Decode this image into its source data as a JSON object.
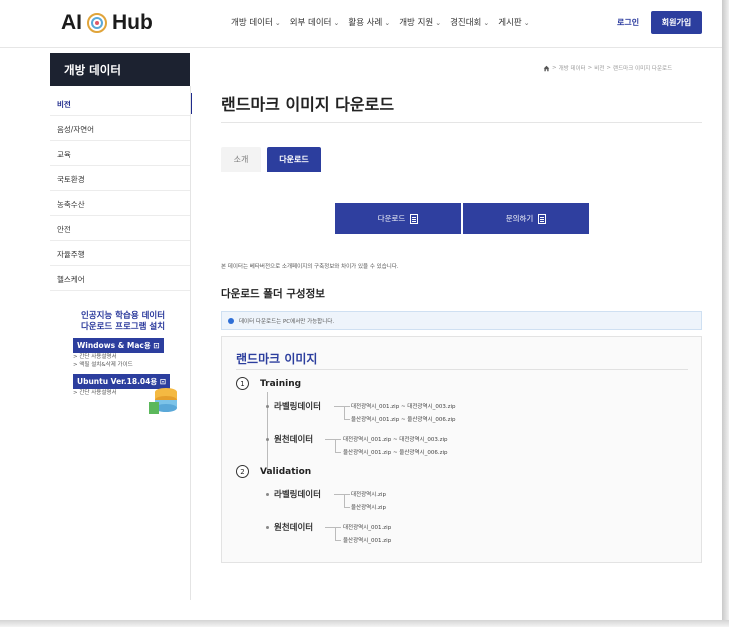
{
  "header": {
    "logo_left": "AI",
    "logo_right": "Hub",
    "nav": [
      {
        "label": "개방 데이터",
        "caret": "⌄"
      },
      {
        "label": "외부 데이터",
        "caret": "⌄"
      },
      {
        "label": "활용 사례",
        "caret": "⌄"
      },
      {
        "label": "개방 지원",
        "caret": "⌄"
      },
      {
        "label": "경진대회",
        "caret": "⌄"
      },
      {
        "label": "게시판",
        "caret": "⌄"
      }
    ],
    "login": "로그인",
    "signup": "회원가입"
  },
  "sidebar": {
    "heading": "개방 데이터",
    "items": [
      {
        "label": "비전"
      },
      {
        "label": "음성/자연어"
      },
      {
        "label": "교육"
      },
      {
        "label": "국토환경"
      },
      {
        "label": "농축수산"
      },
      {
        "label": "안전"
      },
      {
        "label": "자율주행"
      },
      {
        "label": "헬스케어"
      }
    ],
    "promo": {
      "title_line1": "인공지능 학습용 데이터",
      "title_line2": "다운로드 프로그램 설치",
      "mac_badge": "Windows & Mac용 ⊡",
      "mac_links": [
        "> 간단 사용설명서",
        "> 액필 설치&삭제 가이드"
      ],
      "ubuntu_badge": "Ubuntu Ver.18.04용 ⊡",
      "ubuntu_links": [
        "> 간단 사용설명서"
      ]
    }
  },
  "breadcrumb": {
    "items": [
      "개방 데이터",
      "비전",
      "랜드마크 이미지 다운로드"
    ],
    "separator": ">"
  },
  "main": {
    "title": "랜드마크 이미지 다운로드",
    "tabs": [
      {
        "label": "소개"
      },
      {
        "label": "다운로드"
      }
    ],
    "download_button": "다운로드",
    "inquiry_button": "문의하기",
    "notice": "본 데이터는 베타버전으로 소개페이지의 구축정보와 차이가 있을 수 있습니다.",
    "section_title": "다운로드 폴더 구성정보",
    "alert": "데이터 다운로드는 PC에서만 가능합니다."
  },
  "folders": {
    "title": "랜드마크 이미지",
    "splits": [
      {
        "num": "1",
        "name": "Training",
        "groups": [
          {
            "label": "라벨링데이터",
            "files": [
              "대전광역시_001.zip ~ 대전광역시_003.zip",
              "울산광역시_001.zip ~ 울산광역시_006.zip"
            ]
          },
          {
            "label": "원천데이터",
            "files": [
              "대전광역시_001.zip ~ 대전광역시_003.zip",
              "울산광역시_001.zip ~ 울산광역시_006.zip"
            ]
          }
        ]
      },
      {
        "num": "2",
        "name": "Validation",
        "groups": [
          {
            "label": "라벨링데이터",
            "files": [
              "대전광역시.zip",
              "울산광역시.zip"
            ]
          },
          {
            "label": "원천데이터",
            "files": [
              "대전광역시_001.zip",
              "울산광역시_001.zip"
            ]
          }
        ]
      }
    ]
  },
  "colors": {
    "primary": "#2c3e9e",
    "sidebar_head": "#1c2230",
    "alert_bg": "#eef4fb"
  }
}
